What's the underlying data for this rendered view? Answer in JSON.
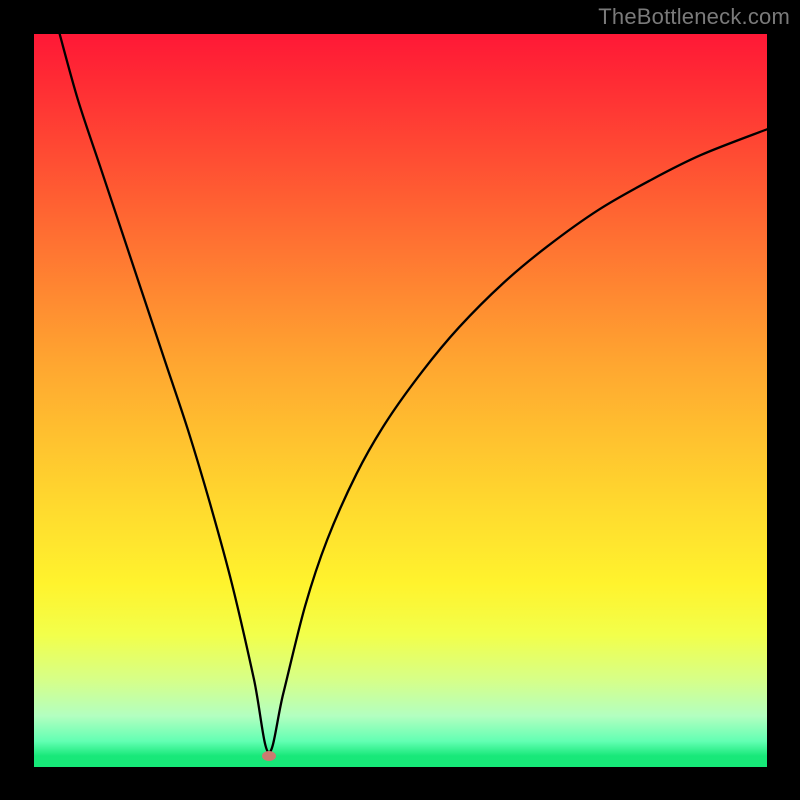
{
  "watermark": "TheBottleneck.com",
  "chart_data": {
    "type": "line",
    "title": "",
    "xlabel": "",
    "ylabel": "",
    "xlim": [
      0,
      100
    ],
    "ylim": [
      0,
      100
    ],
    "grid": false,
    "legend": false,
    "marker": {
      "x": 32,
      "y": 1.5
    },
    "series": [
      {
        "name": "bottleneck-curve",
        "x": [
          3.5,
          6,
          9,
          12,
          15,
          18,
          21,
          24,
          27,
          30,
          32,
          34,
          37,
          40,
          44,
          48,
          53,
          58,
          64,
          70,
          77,
          84,
          91,
          100
        ],
        "y": [
          100,
          91,
          82,
          73,
          64,
          55,
          46,
          36,
          25,
          12,
          2,
          10,
          22,
          31,
          40,
          47,
          54,
          60,
          66,
          71,
          76,
          80,
          83.5,
          87
        ]
      }
    ],
    "colors": {
      "gradient_top": "#ff1836",
      "gradient_bottom": "#16e878",
      "curve": "#000000",
      "marker": "#cb7b70",
      "frame": "#000000",
      "watermark": "#7a7a7a"
    }
  }
}
